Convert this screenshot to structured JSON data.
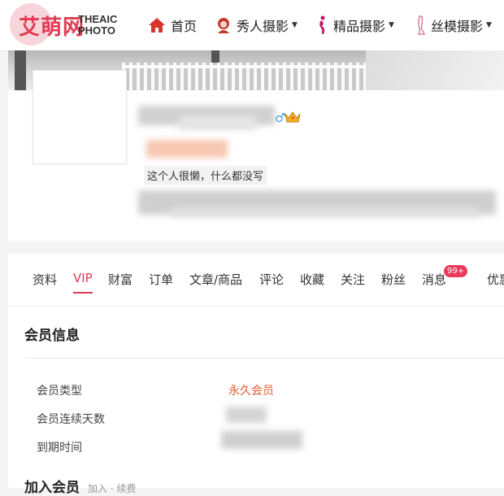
{
  "logo": {
    "cn": "艾萌网",
    "en_line1": "THEAIC",
    "en_line2": "PHOTO"
  },
  "nav": {
    "home": "首页",
    "xiuren": "秀人摄影",
    "jingpin": "精品摄影",
    "simo": "丝模摄影"
  },
  "profile": {
    "bio": "这个人很懒，什么都没写"
  },
  "tabs": [
    {
      "label": "资料"
    },
    {
      "label": "VIP"
    },
    {
      "label": "财富"
    },
    {
      "label": "订单"
    },
    {
      "label": "文章/商品"
    },
    {
      "label": "评论"
    },
    {
      "label": "收藏"
    },
    {
      "label": "关注"
    },
    {
      "label": "粉丝"
    },
    {
      "label": "消息"
    },
    {
      "label": "优惠"
    }
  ],
  "active_tab": "VIP",
  "message_badge": "99+",
  "member": {
    "section_title": "会员信息",
    "type_label": "会员类型",
    "type_value": "永久会员",
    "days_label": "会员连续天数",
    "expire_label": "到期时间"
  },
  "join": {
    "title": "加入会员",
    "sub": "加入 · 续费"
  },
  "colors": {
    "accent": "#e13b55",
    "vip_value": "#e05a2b",
    "badge": "#e93a5c"
  }
}
